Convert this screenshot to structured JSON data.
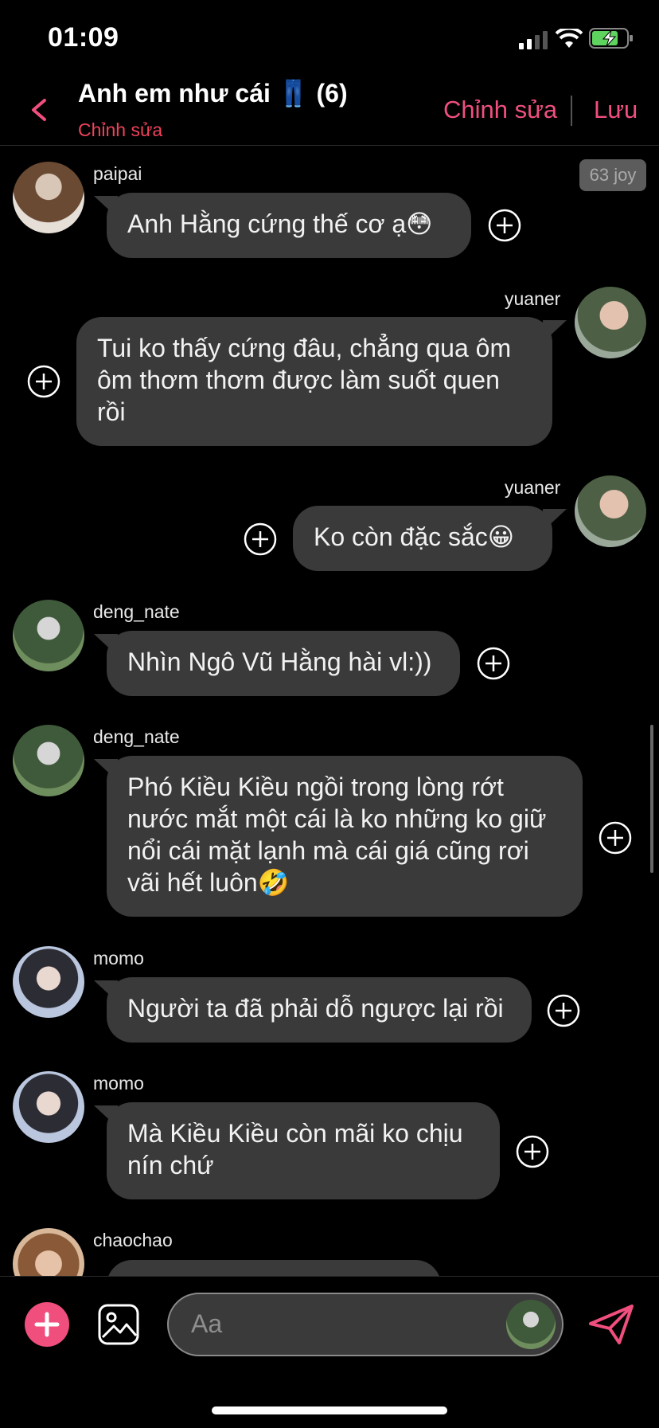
{
  "status": {
    "time": "01:09"
  },
  "header": {
    "title": "Anh em như cái 👖 (6)",
    "subtitle": "Chỉnh sửa",
    "edit_label": "Chỉnh sửa",
    "save_label": "Lưu"
  },
  "badge": "63 joy",
  "messages": [
    {
      "user": "paipai",
      "text": "Anh Hằng cứng thế cơ ạ😳"
    },
    {
      "user": "yuaner",
      "text": "Tui ko thấy cứng đâu, chẳng qua ôm ôm thơm thơm được làm suốt quen rồi"
    },
    {
      "user": "yuaner",
      "text": "Ko còn đặc sắc😀"
    },
    {
      "user": "deng_nate",
      "text": "Nhìn Ngô Vũ Hằng hài vl:))"
    },
    {
      "user": "deng_nate",
      "text": "Phó Kiều Kiều ngồi trong lòng rớt nước mắt một cái là ko những ko giữ nổi cái mặt lạnh mà cái giá cũng rơi vãi hết luôn🤣"
    },
    {
      "user": "momo",
      "text": "Người ta đã phải dỗ ngược lại rồi"
    },
    {
      "user": "momo",
      "text": "Mà Kiều Kiều còn mãi ko chịu nín chứ"
    },
    {
      "user": "chaochao",
      "text": ""
    }
  ],
  "composer": {
    "placeholder": "Aa"
  },
  "colors": {
    "accent": "#f04f7e",
    "bubble": "#3a3a3a",
    "background": "#000000"
  }
}
